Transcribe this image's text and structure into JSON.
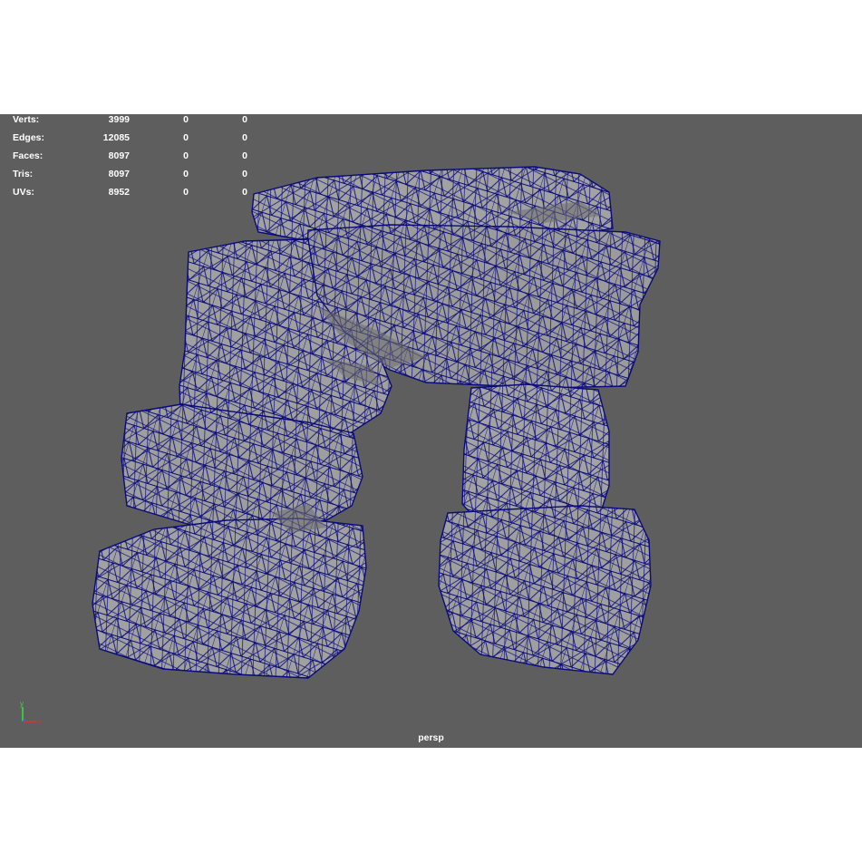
{
  "hud": {
    "rows": [
      {
        "label": "Verts:",
        "v1": "3999",
        "v2": "0",
        "v3": "0"
      },
      {
        "label": "Edges:",
        "v1": "12085",
        "v2": "0",
        "v3": "0"
      },
      {
        "label": "Faces:",
        "v1": "8097",
        "v2": "0",
        "v3": "0"
      },
      {
        "label": "Tris:",
        "v1": "8097",
        "v2": "0",
        "v3": "0"
      },
      {
        "label": "UVs:",
        "v1": "8952",
        "v2": "0",
        "v3": "0"
      }
    ]
  },
  "camera": {
    "name": "persp"
  },
  "axis": {
    "y_label": "y",
    "x_label": "x"
  },
  "colors": {
    "viewport_bg": "#5e5e5e",
    "mesh_fill": "#9d9d9d",
    "wireframe": "#0a0a7a",
    "axis_y": "#3cdc3c",
    "axis_x": "#e03030",
    "axis_z": "#3a5cff"
  }
}
